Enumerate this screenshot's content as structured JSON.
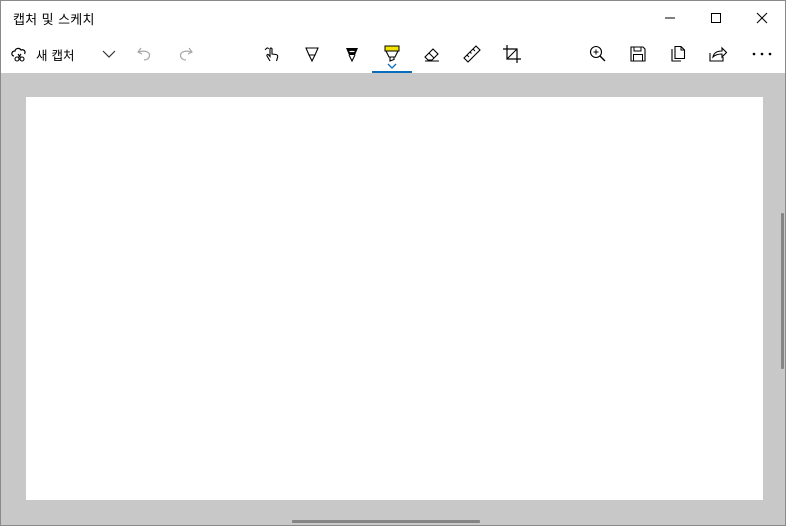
{
  "window": {
    "title": "캡처 및 스케치",
    "controls": [
      "minimize-icon",
      "maximize-icon",
      "close-icon"
    ]
  },
  "toolbar": {
    "new_capture": {
      "label": "새 캡처",
      "icon": "snip-icon"
    },
    "left_tools": [
      "new-capture-dropdown-icon",
      "undo-icon",
      "redo-icon"
    ],
    "drawing_tools": [
      "touch-writing-icon",
      "ballpoint-pen-icon",
      "pencil-icon",
      "highlighter-icon",
      "eraser-icon",
      "ruler-icon",
      "crop-icon"
    ],
    "active_tool": "highlighter-icon",
    "right_tools": [
      "zoom-in-icon",
      "save-icon",
      "copy-icon",
      "share-icon",
      "more-icon"
    ]
  },
  "colors": {
    "accent": "#0a6cbf",
    "highlighter": "#f4e300",
    "canvas_background": "#c8c8c8",
    "paper": "#ffffff"
  }
}
